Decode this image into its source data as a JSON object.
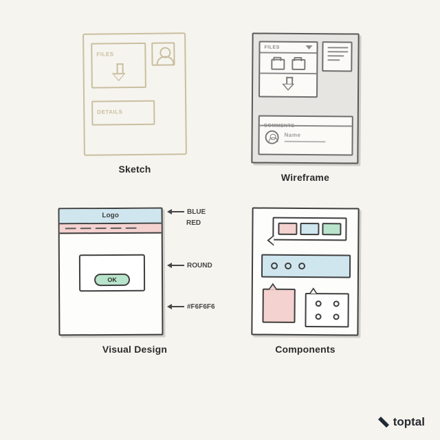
{
  "captions": {
    "sketch": "Sketch",
    "wireframe": "Wireframe",
    "visual_design": "Visual Design",
    "components": "Components"
  },
  "sketch": {
    "files_label": "FILES",
    "details_label": "DETAILS"
  },
  "wireframe": {
    "files_label": "FILES",
    "comments_label": "COMMENTS",
    "name_label": "Name"
  },
  "visual_design": {
    "logo_label": "Logo",
    "ok_label": "OK",
    "annotations": {
      "blue": "BLUE",
      "red": "RED",
      "round": "ROUND",
      "bg_hex": "#F6F6F6"
    }
  },
  "brand": {
    "name": "toptal"
  }
}
